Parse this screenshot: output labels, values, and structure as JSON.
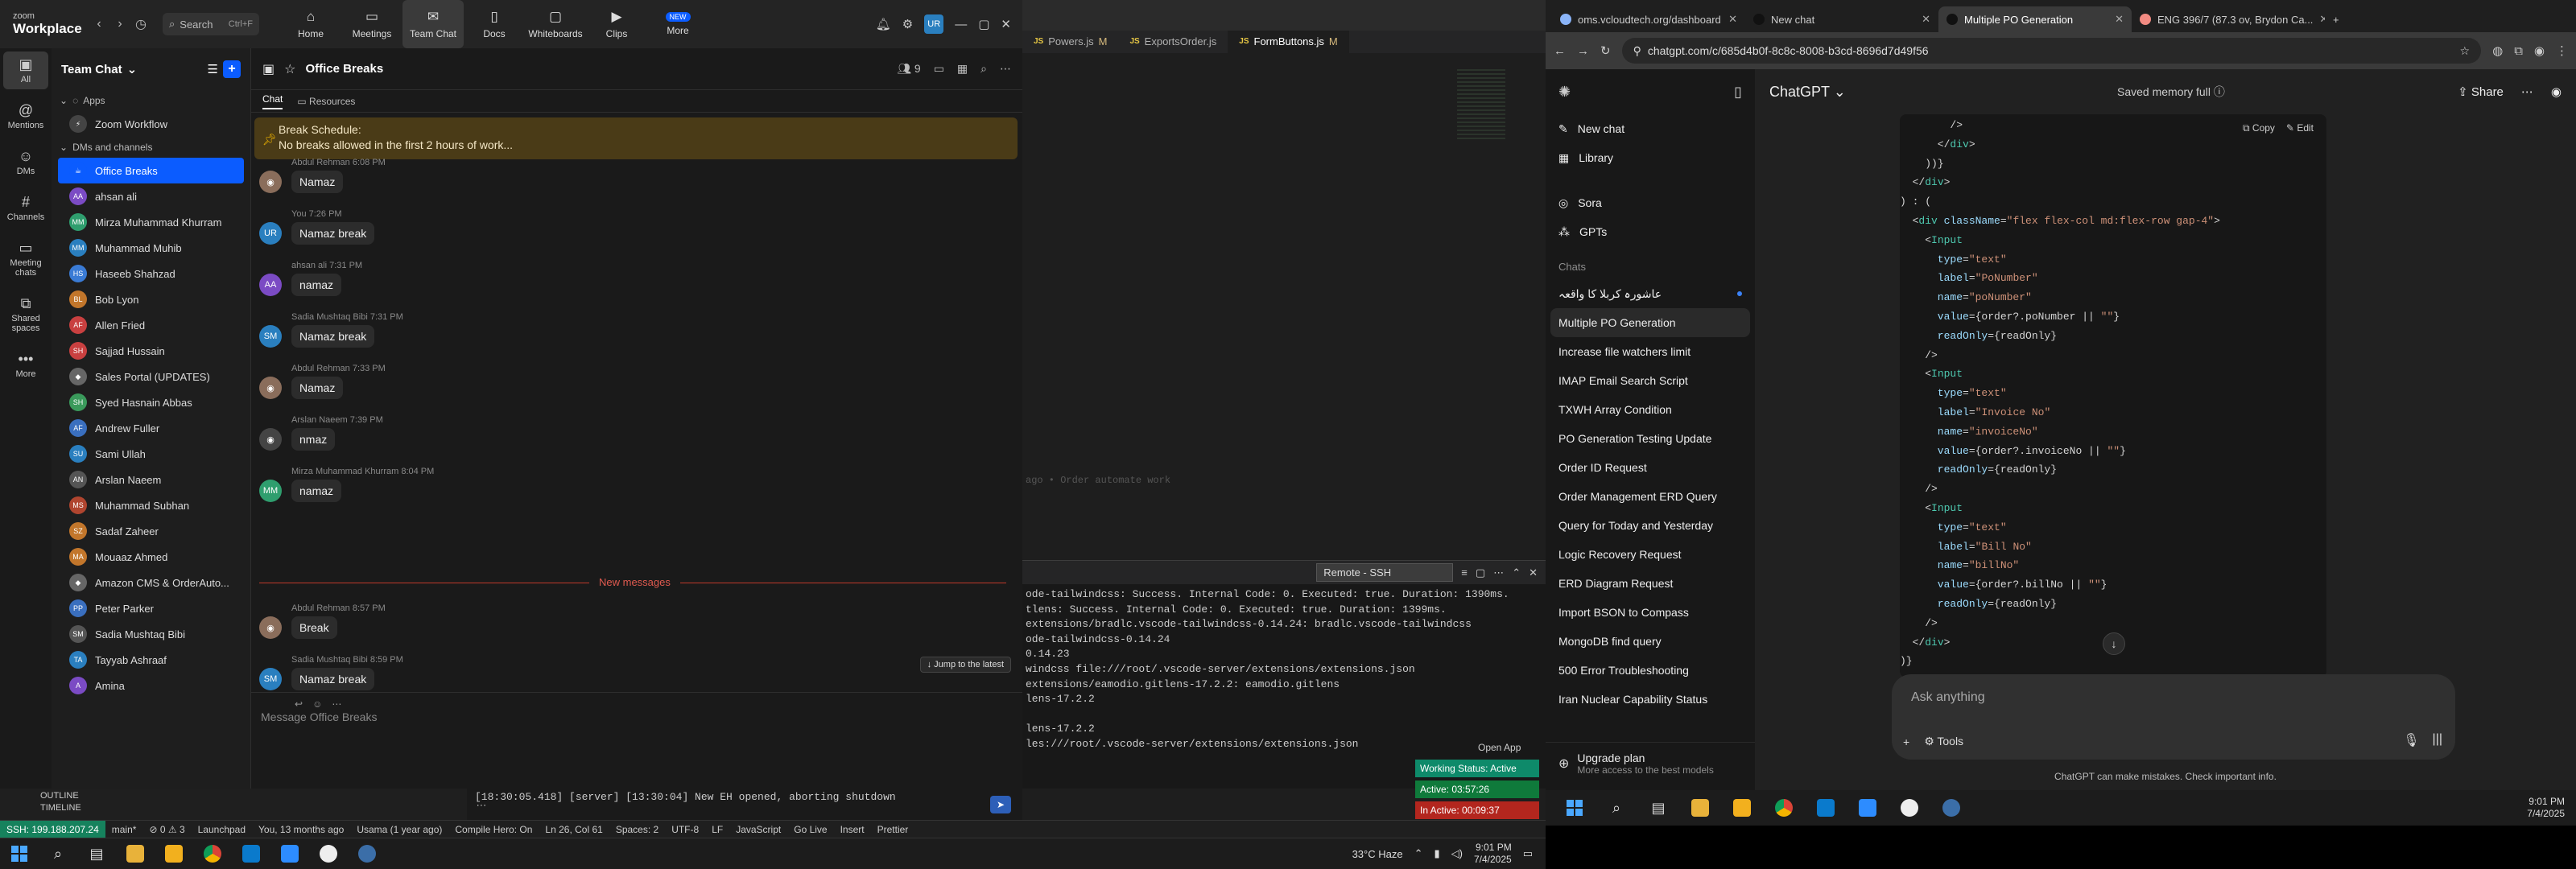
{
  "zoom": {
    "logo_top": "zoom",
    "logo_bottom": "Workplace",
    "search_placeholder": "Search",
    "search_shortcut": "Ctrl+F",
    "tabs": [
      {
        "label": "Home",
        "icon": "home-icon",
        "glyph": "⌂"
      },
      {
        "label": "Meetings",
        "icon": "video-camera-icon",
        "glyph": "▭"
      },
      {
        "label": "Team Chat",
        "icon": "chat-bubble-icon",
        "glyph": "✉"
      },
      {
        "label": "Docs",
        "icon": "document-icon",
        "glyph": "▯"
      },
      {
        "label": "Whiteboards",
        "icon": "whiteboard-icon",
        "glyph": "▢"
      },
      {
        "label": "Clips",
        "icon": "clips-icon",
        "glyph": "▶"
      },
      {
        "label": "More",
        "icon": "more-icon",
        "glyph": "•••"
      }
    ],
    "new_badge": "NEW",
    "user_initials": "UR",
    "rail": [
      {
        "label": "All",
        "glyph": "▣"
      },
      {
        "label": "Mentions",
        "glyph": "@"
      },
      {
        "label": "DMs",
        "glyph": "☺"
      },
      {
        "label": "Channels",
        "glyph": "#"
      },
      {
        "label": "Meeting chats",
        "glyph": "▭"
      },
      {
        "label": "Shared spaces",
        "glyph": "⧉"
      },
      {
        "label": "More",
        "glyph": "•••"
      }
    ],
    "list_title": "Team Chat",
    "apps_label": "Apps",
    "app_item": "Zoom Workflow",
    "dms_label": "DMs and channels",
    "contacts": [
      {
        "name": "Office Breaks",
        "initials": "",
        "color": "#0b5cff"
      },
      {
        "name": "ahsan ali",
        "initials": "AA",
        "color": "#7b4bc4"
      },
      {
        "name": "Mirza Muhammad Khurram",
        "initials": "MM",
        "color": "#2f9e6e"
      },
      {
        "name": "Muhammad Muhib",
        "initials": "MM",
        "color": "#2a7fbf"
      },
      {
        "name": "Haseeb Shahzad",
        "initials": "HS",
        "color": "#3a7bd5"
      },
      {
        "name": "Bob Lyon",
        "initials": "BL",
        "color": "#c2762b"
      },
      {
        "name": "Allen Fried",
        "initials": "AF",
        "color": "#c94040"
      },
      {
        "name": "Sajjad Hussain",
        "initials": "SH",
        "color": "#c94040"
      },
      {
        "name": "Sales Portal (UPDATES)",
        "initials": "",
        "color": "#666"
      },
      {
        "name": "Syed Hasnain Abbas",
        "initials": "SH",
        "color": "#3a9a5b"
      },
      {
        "name": "Andrew Fuller",
        "initials": "AF",
        "color": "#3a6fbf"
      },
      {
        "name": "Sami Ullah",
        "initials": "SU",
        "color": "#2a7fbf"
      },
      {
        "name": "Arslan Naeem",
        "initials": "AN",
        "color": "#555"
      },
      {
        "name": "Muhammad Subhan",
        "initials": "MS",
        "color": "#b0452f"
      },
      {
        "name": "Sadaf Zaheer",
        "initials": "SZ",
        "color": "#c2762b"
      },
      {
        "name": "Mouaaz Ahmed",
        "initials": "MA",
        "color": "#c2762b"
      },
      {
        "name": "Amazon CMS & OrderAuto...",
        "initials": "",
        "color": "#666"
      },
      {
        "name": "Peter Parker",
        "initials": "PP",
        "color": "#3a6fbf"
      },
      {
        "name": "Sadia Mushtaq Bibi",
        "initials": "SM",
        "color": "#555"
      },
      {
        "name": "Tayyab Ashraaf",
        "initials": "TA",
        "color": "#2a7fbf"
      },
      {
        "name": "Amina",
        "initials": "A",
        "color": "#7b4bc4"
      }
    ],
    "chat_title": "Office Breaks",
    "member_count": "9",
    "subtab_chat": "Chat",
    "subtab_resources": "Resources",
    "banner_line1": "Break Schedule:",
    "banner_line2": "No breaks allowed in the first 2 hours of work...",
    "messages": [
      {
        "sender": "Abdul Rehman",
        "time": "6:08 PM",
        "text": "Namaz",
        "initials": "",
        "color": "#8a6d5b"
      },
      {
        "sender": "You",
        "time": "7:26 PM",
        "text": "Namaz break",
        "initials": "UR",
        "color": "#2a7fbf"
      },
      {
        "sender": "ahsan ali",
        "time": "7:31 PM",
        "text": "namaz",
        "initials": "AA",
        "color": "#7b4bc4"
      },
      {
        "sender": "Sadia Mushtaq Bibi",
        "time": "7:31 PM",
        "text": "Namaz break",
        "initials": "SM",
        "color": "#2a7fbf"
      },
      {
        "sender": "Abdul Rehman",
        "time": "7:33 PM",
        "text": "Namaz",
        "initials": "",
        "color": "#8a6d5b"
      },
      {
        "sender": "Arslan Naeem",
        "time": "7:39 PM",
        "text": "nmaz",
        "initials": "",
        "color": "#444"
      },
      {
        "sender": "Mirza Muhammad Khurram",
        "time": "8:04 PM",
        "text": "namaz",
        "initials": "MM",
        "color": "#2f9e6e"
      },
      {
        "sender": "Abdul Rehman",
        "time": "8:57 PM",
        "text": "Break",
        "initials": "",
        "color": "#8a6d5b"
      },
      {
        "sender": "Sadia Mushtaq Bibi",
        "time": "8:59 PM",
        "text": "Namaz break",
        "initials": "SM",
        "color": "#2a7fbf"
      }
    ],
    "new_messages_label": "New messages",
    "jump_latest": "Jump to the latest",
    "input_placeholder": "Message Office Breaks"
  },
  "vscode": {
    "tabs": [
      {
        "name": "Powers.js",
        "mod": "M"
      },
      {
        "name": "ExportsOrder.js",
        "mod": ""
      },
      {
        "name": "FormButtons.js",
        "mod": "M"
      }
    ],
    "ghost_text": "ago • Order automate work",
    "remote_select": "Remote - SSH",
    "terminal_lines": [
      "ode-tailwindcss: Success. Internal Code: 0. Executed: true. Duration: 1390ms.",
      "tlens: Success. Internal Code: 0. Executed: true. Duration: 1399ms.",
      "extensions/bradlc.vscode-tailwindcss-0.14.24: bradlc.vscode-tailwindcss",
      "ode-tailwindcss-0.14.24",
      "0.14.23",
      "windcss file:///root/.vscode-server/extensions/extensions.json",
      "extensions/eamodio.gitlens-17.2.2: eamodio.gitlens",
      "lens-17.2.2",
      "",
      "lens-17.2.2",
      "les:///root/.vscode-server/extensions/extensions.json"
    ],
    "log_line": "[18:30:05.418] [server] [13:30:04] New EH opened, aborting shutdown",
    "outline": "OUTLINE",
    "timeline": "TIMELINE",
    "status_ssh": "SSH: 199.188.207.24",
    "status_items": [
      "main*",
      "⊘ 0 ⚠ 3",
      "Launchpad",
      "You, 13 months ago",
      "Usama (1 year ago)",
      "Compile Hero: On",
      "Ln 26, Col 61",
      "Spaces: 2",
      "UTF-8",
      "LF",
      "JavaScript",
      "Go Live",
      "Insert",
      "Prettier"
    ],
    "open_app": "Open App",
    "working_status": "Working Status: Active",
    "active_time": "Active: 03:57:26",
    "inactive_time": "In Active: 00:09:37"
  },
  "taskbar_left": {
    "weather": "33°C  Haze",
    "time": "9:01 PM",
    "date": "7/4/2025"
  },
  "chrome": {
    "tabs": [
      {
        "title": "oms.vcloudtech.org/dashboard"
      },
      {
        "title": "New chat"
      },
      {
        "title": "Multiple PO Generation"
      },
      {
        "title": "ENG 396/7 (87.3 ov, Brydon Ca..."
      }
    ],
    "url": "chatgpt.com/c/685d4b0f-8c8c-8008-b3cd-8696d7d49f56"
  },
  "chatgpt": {
    "sidebar_items": [
      {
        "label": "New chat",
        "icon": "compose-icon",
        "glyph": "✎"
      },
      {
        "label": "Library",
        "icon": "library-icon",
        "glyph": "▦"
      },
      {
        "label": "Sora",
        "icon": "sora-icon",
        "glyph": "◎"
      },
      {
        "label": "GPTs",
        "icon": "gpts-icon",
        "glyph": "⁂"
      }
    ],
    "chats_label": "Chats",
    "chats": [
      "عاشورہ کربلا کا واقعہ",
      "Multiple PO Generation",
      "Increase file watchers limit",
      "IMAP Email Search Script",
      "TXWH Array Condition",
      "PO Generation Testing Update",
      "Order ID Request",
      "Order Management ERD Query",
      "Query for Today and Yesterday",
      "Logic Recovery Request",
      "ERD Diagram Request",
      "Import BSON to Compass",
      "MongoDB find query",
      "500 Error Troubleshooting",
      "Iran Nuclear Capability Status"
    ],
    "upgrade_title": "Upgrade plan",
    "upgrade_sub": "More access to the best models",
    "model": "ChatGPT",
    "memory": "Saved memory full",
    "share": "Share",
    "copy": "Copy",
    "edit": "Edit",
    "input_placeholder": "Ask anything",
    "tools_label": "Tools",
    "footer": "ChatGPT can make mistakes. Check important info."
  },
  "taskbar_right": {
    "time": "9:01 PM",
    "date": "7/4/2025"
  }
}
